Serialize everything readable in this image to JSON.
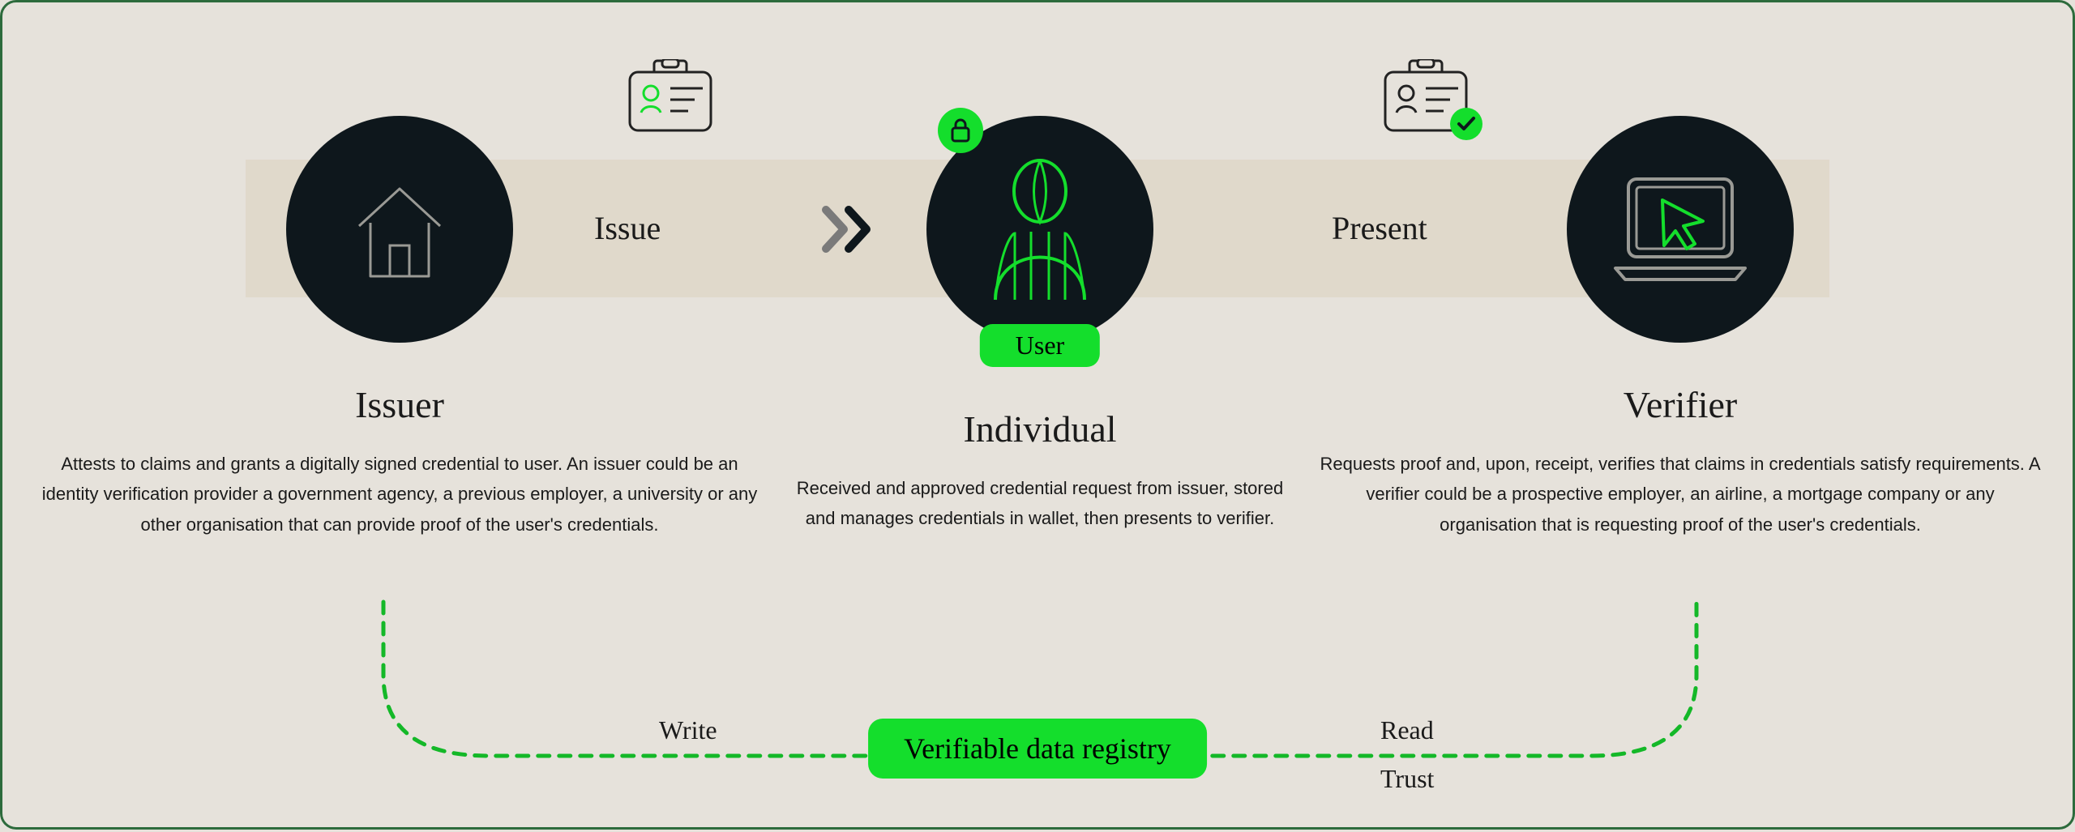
{
  "flow": {
    "issue_label": "Issue",
    "present_label": "Present"
  },
  "issuer": {
    "title": "Issuer",
    "description": "Attests to claims and grants a digitally signed credential to user. An issuer could be an identity verification provider a government agency, a previous employer, a university or any other organisation that can provide proof of the user's credentials."
  },
  "individual": {
    "chip": "User",
    "title": "Individual",
    "description": "Received and approved credential request from issuer, stored and manages credentials in wallet, then presents to verifier."
  },
  "verifier": {
    "title": "Verifier",
    "description": "Requests proof and, upon, receipt, verifies that claims in credentials satisfy requirements. A verifier could be a prospective employer, an airline, a mortgage company or any organisation that is requesting proof of the user's credentials."
  },
  "registry": {
    "chip": "Verifiable data registry",
    "write_label": "Write",
    "read_label": "Read",
    "trust_label": "Trust"
  }
}
